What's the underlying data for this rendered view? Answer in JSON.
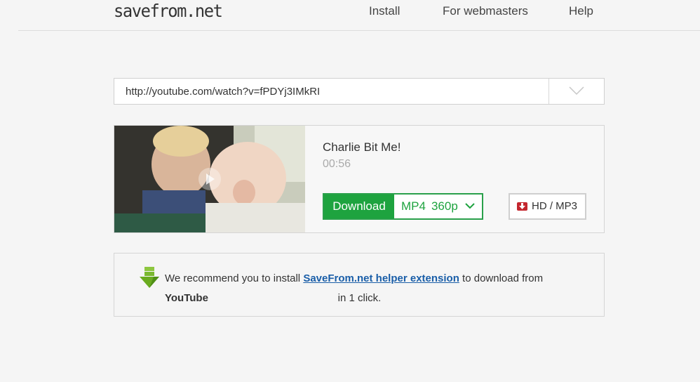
{
  "header": {
    "logo": "savefrom.net",
    "nav": [
      "Install",
      "For webmasters",
      "Help"
    ]
  },
  "url_input": {
    "value": "http://youtube.com/watch?v=fPDYj3IMkRI"
  },
  "result": {
    "title": "Charlie Bit Me!",
    "duration": "00:56",
    "download_label": "Download",
    "format": "MP4",
    "quality": "360p",
    "hd_label": "HD / MP3"
  },
  "recommend": {
    "text_before": "We recommend you to install ",
    "link_text": "SaveFrom.net helper extension",
    "text_middle": " to download from ",
    "service": "YouTube",
    "text_after": "in 1 click."
  },
  "colors": {
    "accent_green": "#1ea33f",
    "link_blue": "#1a5ea8",
    "hd_red": "#c4262e"
  },
  "icons": [
    "chevron-down-icon",
    "play-icon",
    "download-arrow-icon",
    "green-download-arrow-icon"
  ]
}
